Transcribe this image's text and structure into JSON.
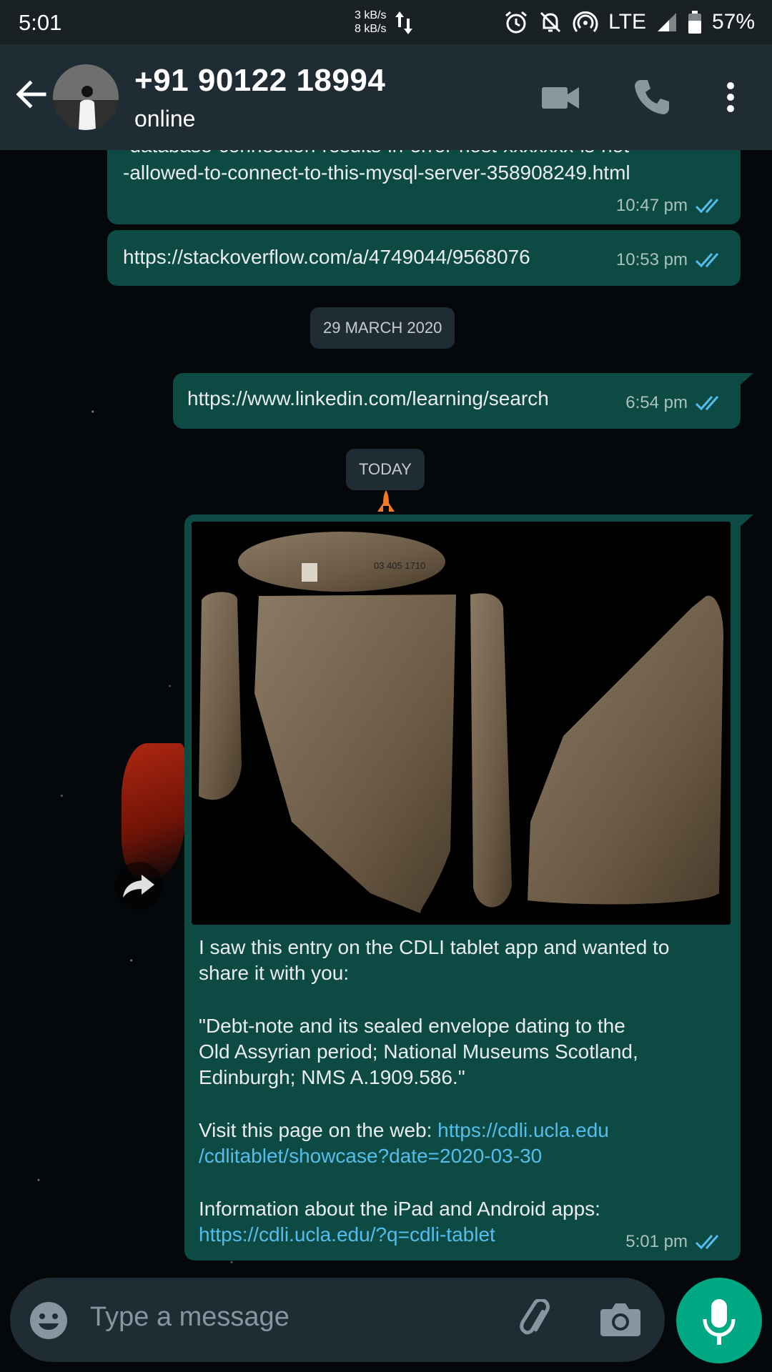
{
  "status_bar": {
    "time": "5:01",
    "net_up": "3 kB/s",
    "net_down": "8 kB/s",
    "network": "LTE",
    "battery": "57%"
  },
  "header": {
    "contact_name": "+91 90122 18994",
    "contact_status": "online",
    "icons": [
      "back-arrow-icon",
      "video-call-icon",
      "phone-call-icon",
      "more-options-icon"
    ]
  },
  "messages": [
    {
      "text_line1": "-database-connection-results-in-error-host-xxxxxxx-is-not",
      "text_line2": "-allowed-to-connect-to-this-mysql-server-358908249.html",
      "time": "10:47 pm"
    },
    {
      "text": "https://stackoverflow.com/a/4749044/9568076",
      "time": "10:53 pm"
    },
    {
      "date_divider": "29 MARCH 2020"
    },
    {
      "text": "https://www.linkedin.com/learning/search",
      "time": "6:54 pm"
    },
    {
      "date_divider": "TODAY"
    },
    {
      "image_label": "03 405 1710",
      "para1_line1": "I saw this entry on the CDLI tablet app and wanted to",
      "para1_line2": "share it with you:",
      "para2_line1": "\"Debt-note and its sealed envelope dating to the",
      "para2_line2": "Old Assyrian period; National Museums Scotland,",
      "para2_line3": "Edinburgh; NMS A.1909.586.\"",
      "para3_prefix": "Visit this page on the web: ",
      "para3_link1": "https://cdli.ucla.edu",
      "para3_link2": "/cdlitablet/showcase?date=2020-03-30",
      "para4_line1": "Information about the iPad and Android apps:",
      "para4_link": "https://cdli.ucla.edu/?q=cdli-tablet",
      "time": "5:01 pm"
    }
  ],
  "composer": {
    "placeholder": "Type a message"
  },
  "colors": {
    "bubble_out": "#0d4a44",
    "link": "#53bdeb",
    "accent": "#00a884",
    "header": "#1f2c33",
    "read_ticks": "#53bdeb"
  }
}
